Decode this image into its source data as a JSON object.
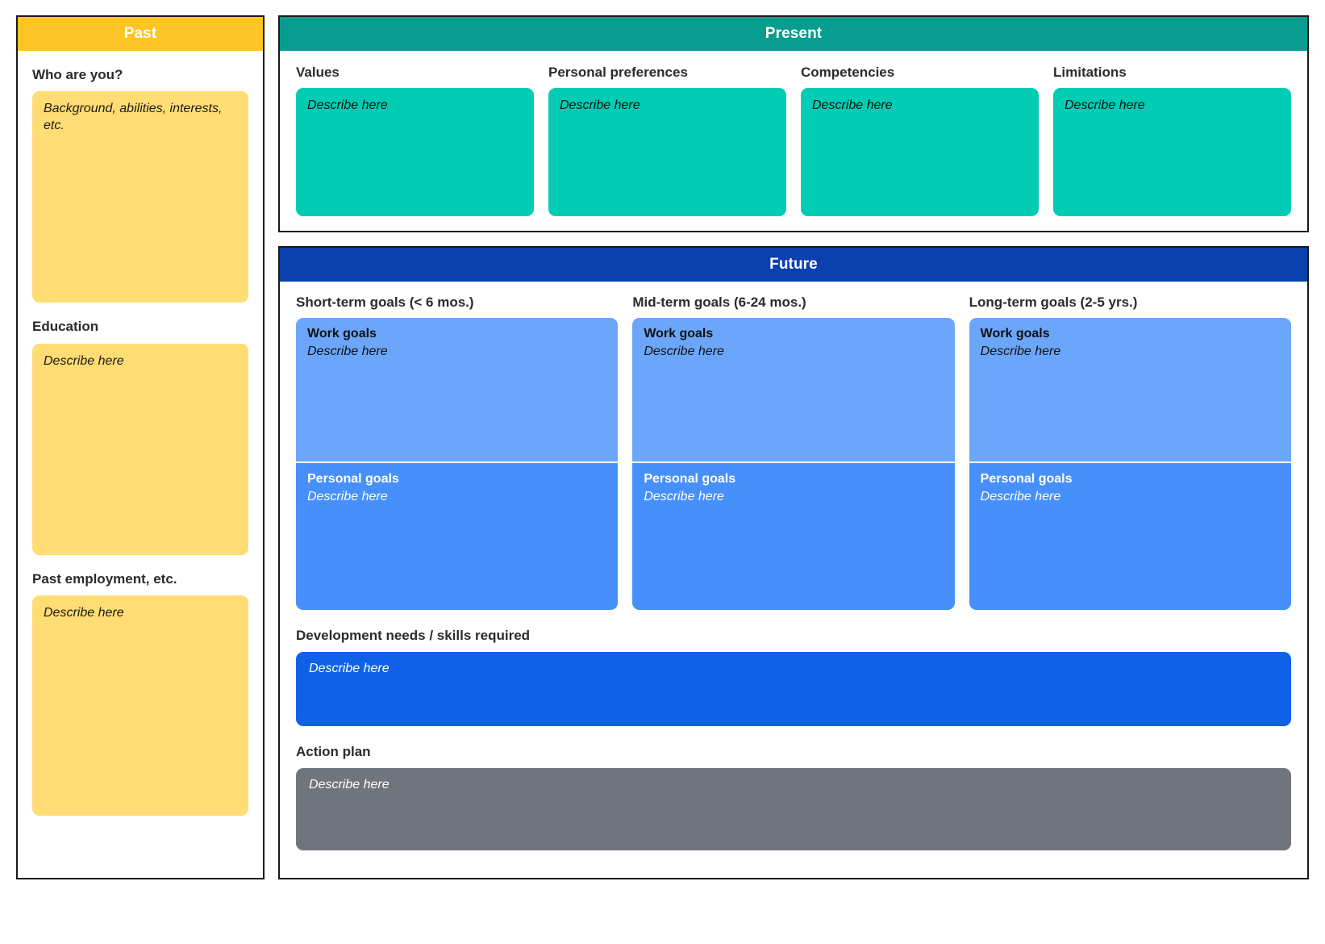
{
  "past": {
    "header": "Past",
    "sections": [
      {
        "label": "Who are you?",
        "placeholder": "Background, abilities, interests, etc."
      },
      {
        "label": "Education",
        "placeholder": "Describe here"
      },
      {
        "label": "Past employment, etc.",
        "placeholder": "Describe here"
      }
    ]
  },
  "present": {
    "header": "Present",
    "columns": [
      {
        "label": "Values",
        "placeholder": "Describe here"
      },
      {
        "label": "Personal preferences",
        "placeholder": "Describe here"
      },
      {
        "label": "Competencies",
        "placeholder": "Describe here"
      },
      {
        "label": "Limitations",
        "placeholder": "Describe here"
      }
    ]
  },
  "future": {
    "header": "Future",
    "goal_columns": [
      {
        "label": "Short-term goals (< 6 mos.)",
        "work": {
          "title": "Work goals",
          "placeholder": "Describe here"
        },
        "personal": {
          "title": "Personal goals",
          "placeholder": "Describe here"
        }
      },
      {
        "label": "Mid-term goals (6-24 mos.)",
        "work": {
          "title": "Work goals",
          "placeholder": "Describe here"
        },
        "personal": {
          "title": "Personal goals",
          "placeholder": "Describe here"
        }
      },
      {
        "label": "Long-term goals (2-5 yrs.)",
        "work": {
          "title": "Work goals",
          "placeholder": "Describe here"
        },
        "personal": {
          "title": "Personal goals",
          "placeholder": "Describe here"
        }
      }
    ],
    "development": {
      "label": "Development needs / skills required",
      "placeholder": "Describe here"
    },
    "action_plan": {
      "label": "Action plan",
      "placeholder": "Describe here"
    }
  },
  "colors": {
    "past_header": "#FFC425",
    "past_note": "#FFDC74",
    "present_header": "#089C8E",
    "present_note": "#03CCB4",
    "future_header": "#0B41AE",
    "work_goal": "#6BA6FB",
    "personal_goal": "#4790FC",
    "development_bar": "#0F62E8",
    "action_plan_bar": "#70757D",
    "outline": "#1A1A1A"
  }
}
